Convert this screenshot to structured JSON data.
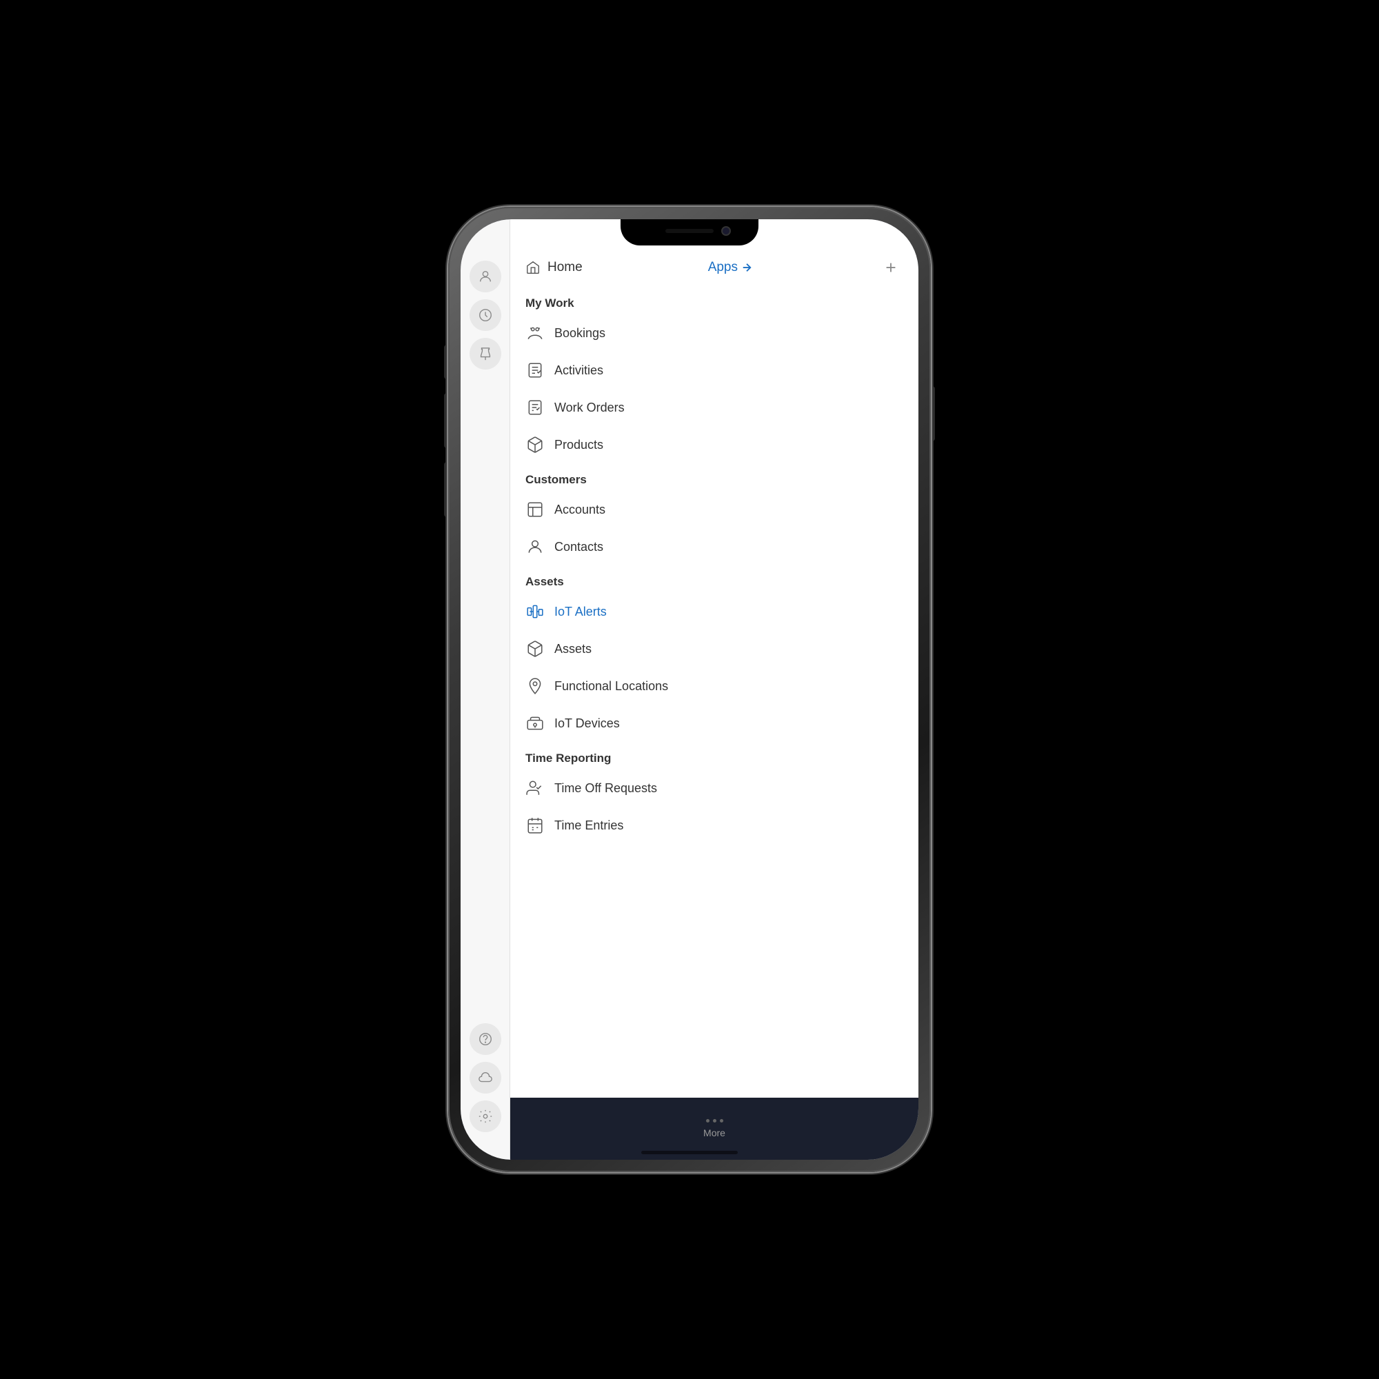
{
  "colors": {
    "accent": "#1a6fc4",
    "text_primary": "#333",
    "text_secondary": "#888",
    "bg_white": "#ffffff",
    "bg_light": "#f7f7f7"
  },
  "top_bar": {
    "home_label": "Home",
    "apps_label": "Apps →",
    "plus_icon": "plus-icon"
  },
  "sections": [
    {
      "id": "my_work",
      "label": "My Work",
      "items": [
        {
          "id": "bookings",
          "label": "Bookings",
          "icon": "bookings-icon"
        },
        {
          "id": "activities",
          "label": "Activities",
          "icon": "activities-icon"
        },
        {
          "id": "work_orders",
          "label": "Work Orders",
          "icon": "work-orders-icon"
        },
        {
          "id": "products",
          "label": "Products",
          "icon": "products-icon"
        }
      ]
    },
    {
      "id": "customers",
      "label": "Customers",
      "items": [
        {
          "id": "accounts",
          "label": "Accounts",
          "icon": "accounts-icon"
        },
        {
          "id": "contacts",
          "label": "Contacts",
          "icon": "contacts-icon"
        }
      ]
    },
    {
      "id": "assets",
      "label": "Assets",
      "items": [
        {
          "id": "iot_alerts",
          "label": "IoT Alerts",
          "icon": "iot-alerts-icon",
          "active": true
        },
        {
          "id": "assets",
          "label": "Assets",
          "icon": "assets-icon"
        },
        {
          "id": "functional_locations",
          "label": "Functional Locations",
          "icon": "functional-locations-icon"
        },
        {
          "id": "iot_devices",
          "label": "IoT Devices",
          "icon": "iot-devices-icon"
        }
      ]
    },
    {
      "id": "time_reporting",
      "label": "Time Reporting",
      "items": [
        {
          "id": "time_off_requests",
          "label": "Time Off Requests",
          "icon": "time-off-icon"
        },
        {
          "id": "time_entries",
          "label": "Time Entries",
          "icon": "time-entries-icon"
        }
      ]
    }
  ],
  "sidebar_icons": [
    {
      "id": "profile",
      "icon": "person-icon"
    },
    {
      "id": "history",
      "icon": "clock-icon"
    },
    {
      "id": "pinned",
      "icon": "pin-icon"
    }
  ],
  "sidebar_bottom_icons": [
    {
      "id": "help",
      "icon": "help-icon"
    },
    {
      "id": "cloud",
      "icon": "cloud-icon"
    },
    {
      "id": "settings",
      "icon": "settings-icon"
    }
  ],
  "bottom_bar": {
    "more_label": "More"
  }
}
